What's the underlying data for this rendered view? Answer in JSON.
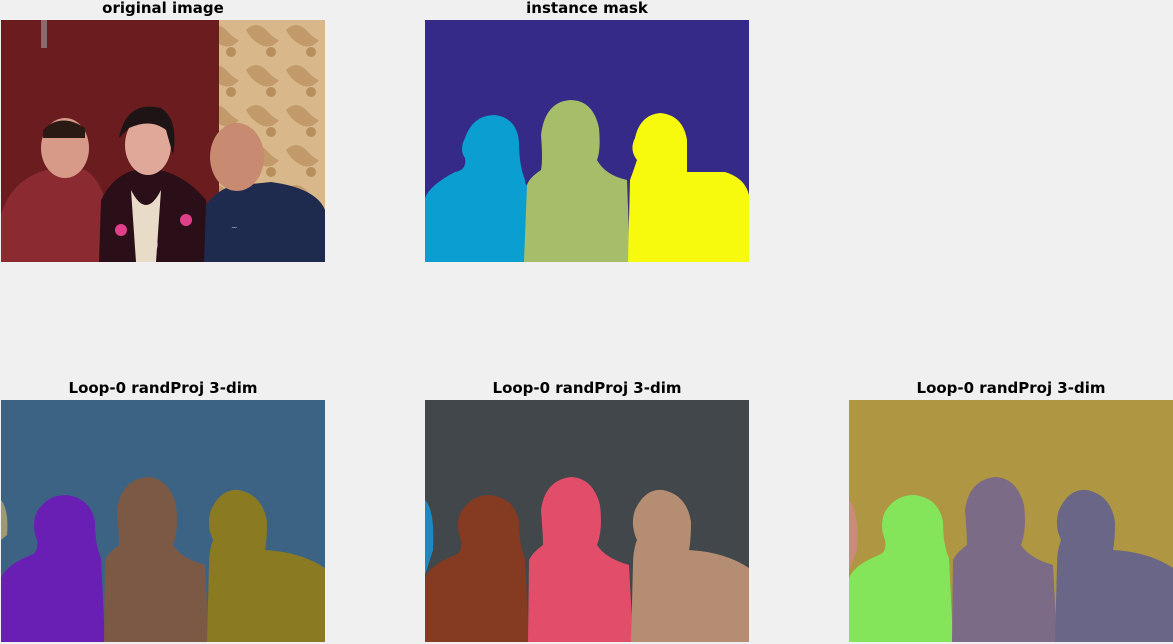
{
  "panels": {
    "original": {
      "title": "original image"
    },
    "mask": {
      "title": "instance mask",
      "colors": {
        "background": "#352a87",
        "person1": "#0a9fd0",
        "person2": "#a6bd6a",
        "person3": "#f8fa0d"
      }
    },
    "proj1": {
      "title": "Loop-0 randProj 3-dim",
      "colors": {
        "background": "#3d6384",
        "person1": "#6a1fb4",
        "person2": "#7b5944",
        "person3": "#8a7a22"
      }
    },
    "proj2": {
      "title": "Loop-0 randProj 3-dim",
      "colors": {
        "background": "#41474b",
        "person1": "#853a22",
        "person2": "#e24d69",
        "person3": "#b58d73"
      }
    },
    "proj3": {
      "title": "Loop-0 randProj 3-dim",
      "colors": {
        "background": "#ae9642",
        "person1": "#85e55a",
        "person2": "#7b6b86",
        "person3": "#6a6688"
      }
    }
  }
}
